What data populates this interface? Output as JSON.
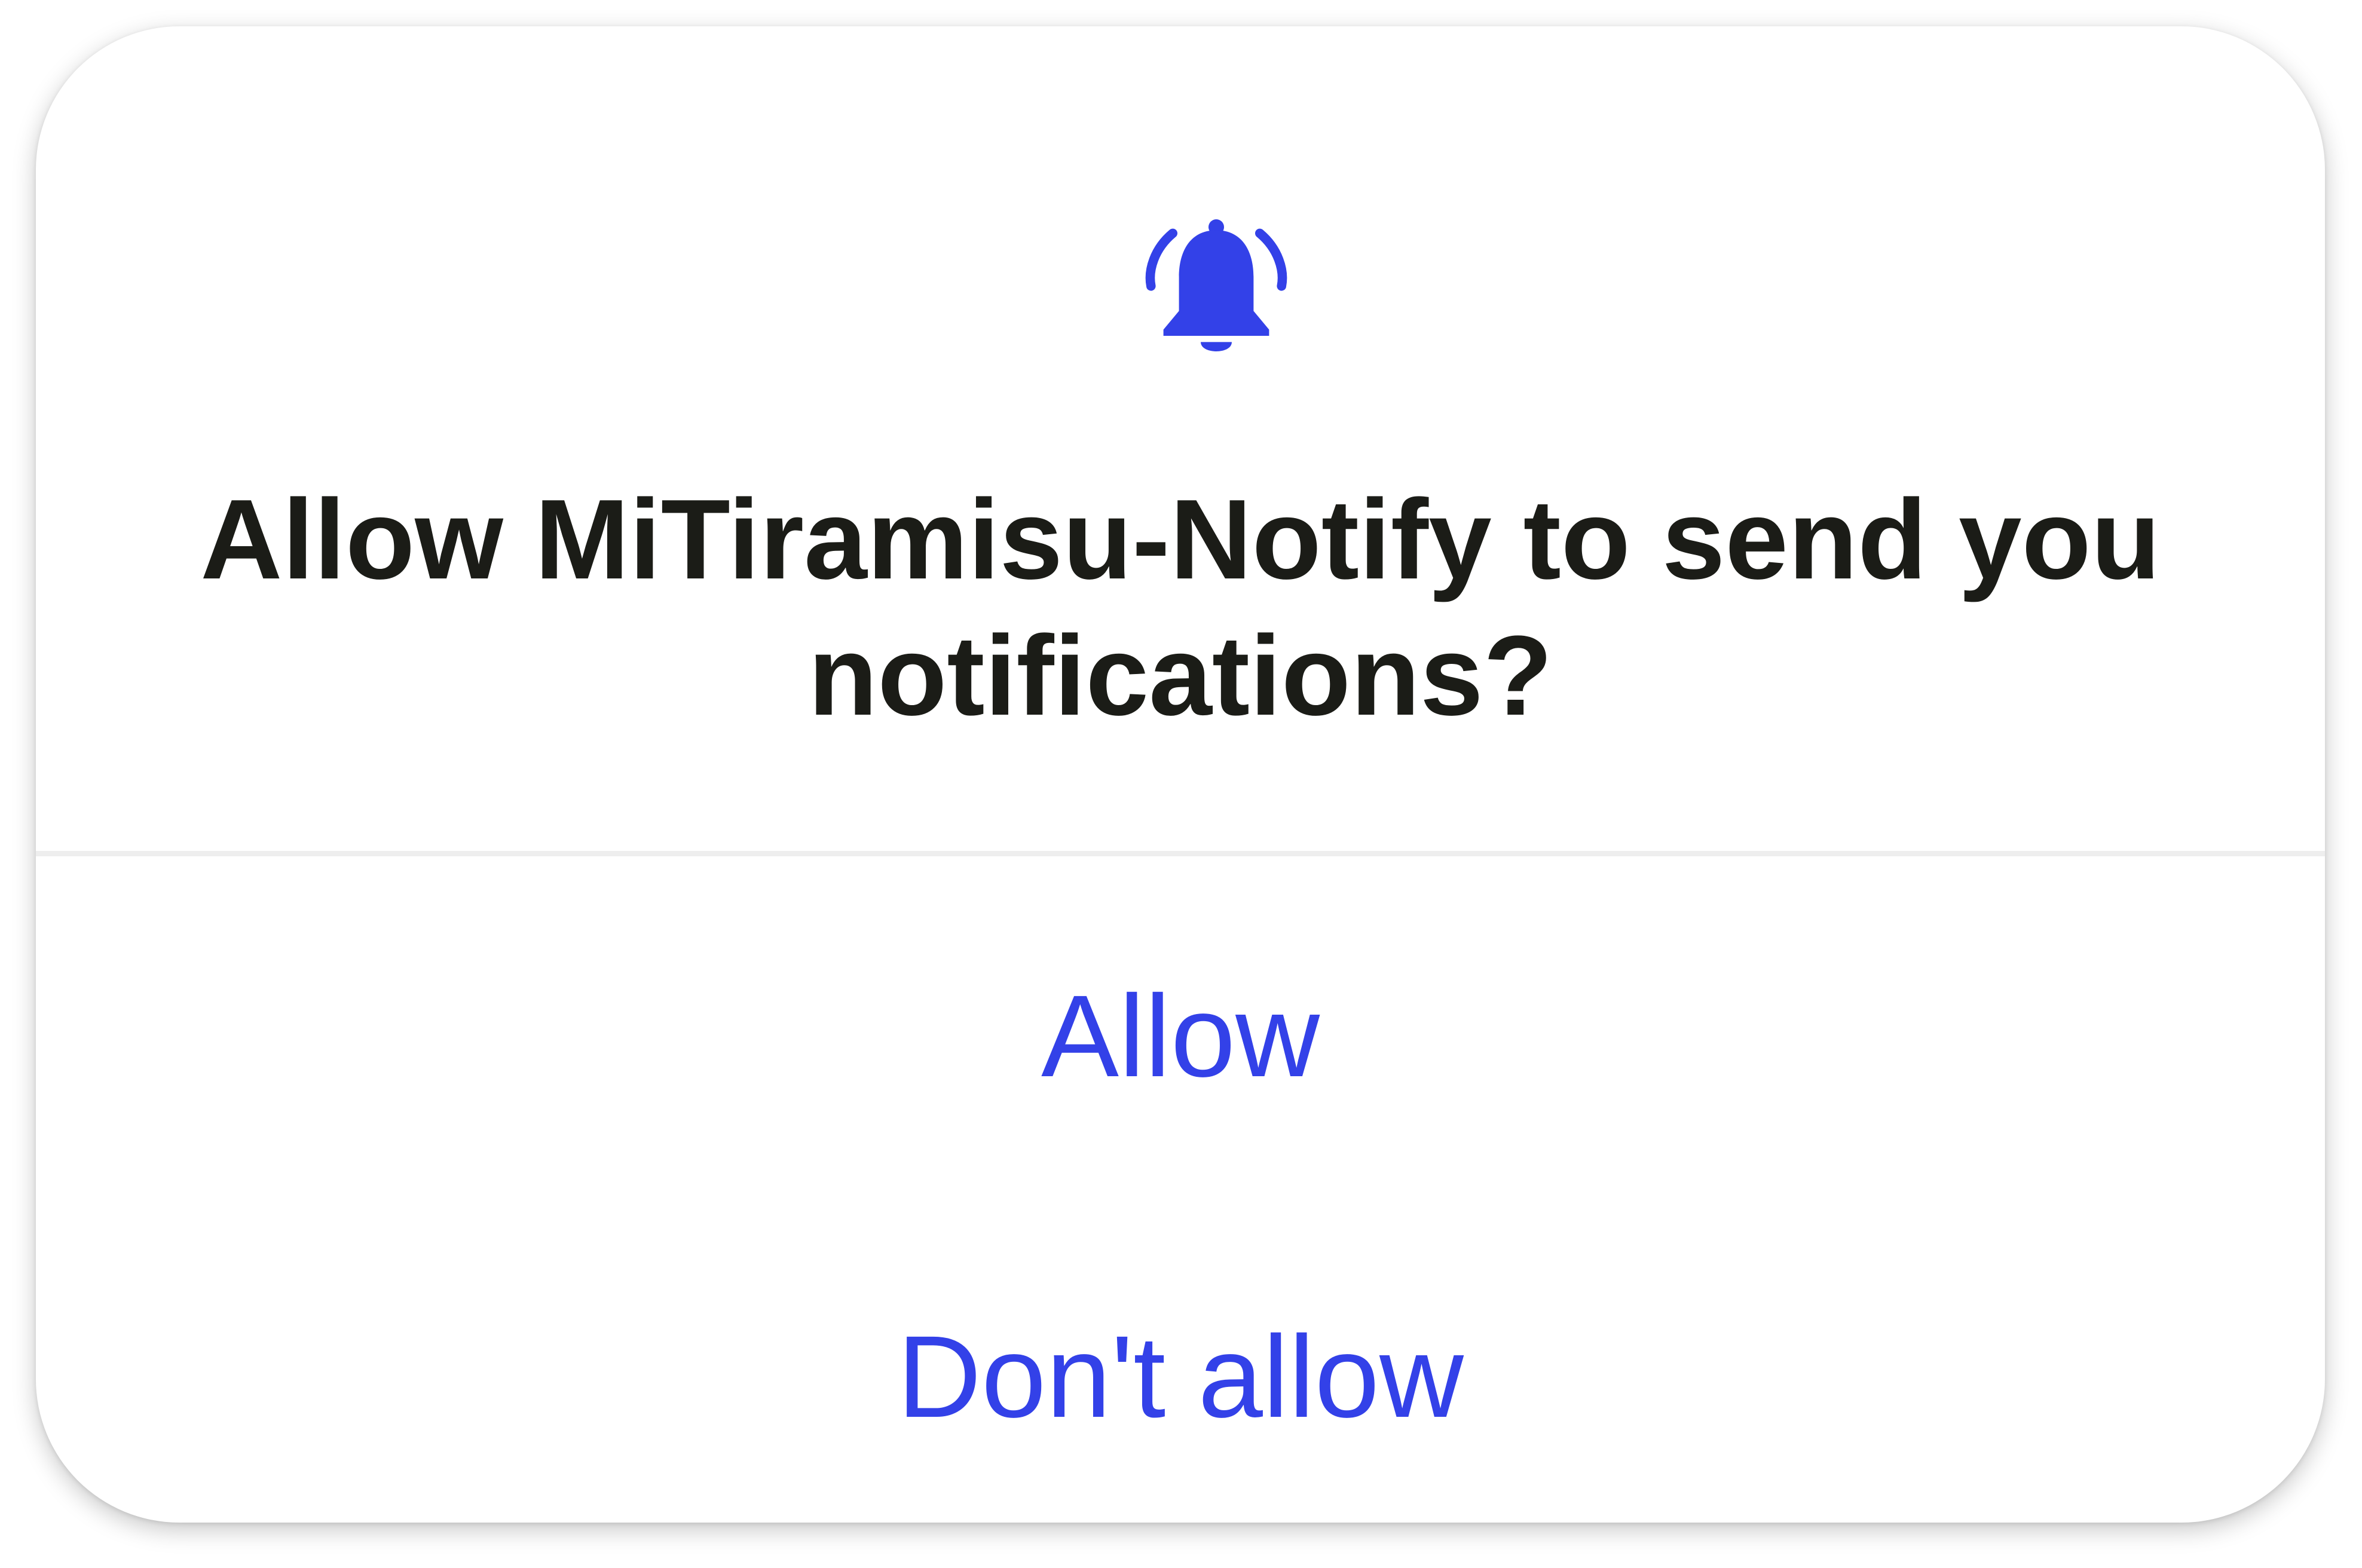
{
  "dialog": {
    "title": "Allow MiTiramisu-Notify to send you notifications?",
    "icon": "notification-bell-icon",
    "accent_color": "#3341e8",
    "text_color": "#1b1c17",
    "actions": {
      "allow_label": "Allow",
      "deny_label": "Don't allow"
    }
  }
}
